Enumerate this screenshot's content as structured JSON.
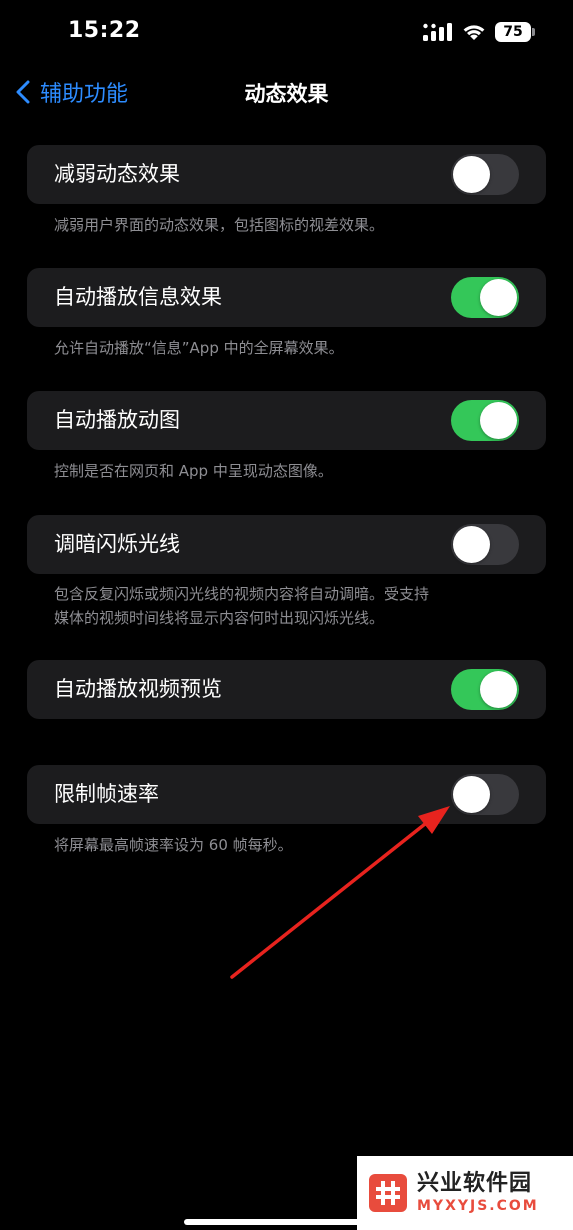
{
  "status_bar": {
    "time": "15:22",
    "battery": "75"
  },
  "nav": {
    "back_label": "辅助功能",
    "title": "动态效果"
  },
  "settings": [
    {
      "label": "减弱动态效果",
      "on": false,
      "footnote": [
        "减弱用户界面的动态效果，包括图标的视差效果。"
      ]
    },
    {
      "label": "自动播放信息效果",
      "on": true,
      "footnote": [
        "允许自动播放“信息”App 中的全屏幕效果。"
      ]
    },
    {
      "label": "自动播放动图",
      "on": true,
      "footnote": [
        "控制是否在网页和 App 中呈现动态图像。"
      ]
    },
    {
      "label": "调暗闪烁光线",
      "on": false,
      "footnote": [
        "包含反复闪烁或频闪光线的视频内容将自动调暗。受支持",
        "媒体的视频时间线将显示内容何时出现闪烁光线。"
      ]
    },
    {
      "label": "自动播放视频预览",
      "on": true,
      "footnote": []
    },
    {
      "label": "限制帧速率",
      "on": false,
      "footnote": [
        "将屏幕最高帧速率设为 60 帧每秒。"
      ]
    }
  ],
  "colors": {
    "accent": "#2d8cff",
    "toggle_on": "#34c759",
    "toggle_off": "#39393d",
    "arrow": "#e8231e"
  },
  "watermark": {
    "name": "兴业软件园",
    "url": "MYXYJS.COM"
  }
}
